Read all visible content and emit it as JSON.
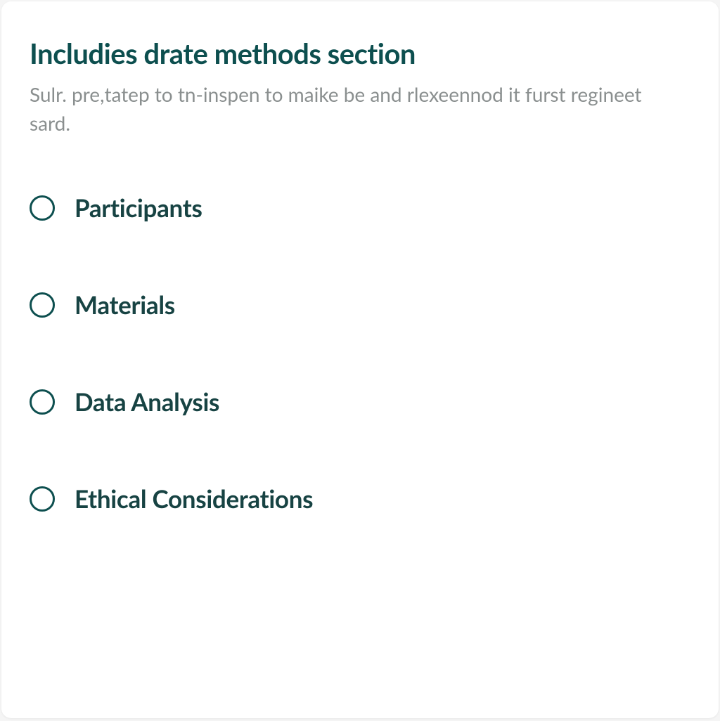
{
  "header": {
    "title": "Includies drate methods section",
    "subtitle": "Sulr. pre,tatep to tn-inspen to maike be and rlexeennod it furst regineet sard."
  },
  "options": [
    {
      "label": "Participants"
    },
    {
      "label": "Materials"
    },
    {
      "label": "Data Analysis"
    },
    {
      "label": "Ethical Considerations"
    }
  ]
}
